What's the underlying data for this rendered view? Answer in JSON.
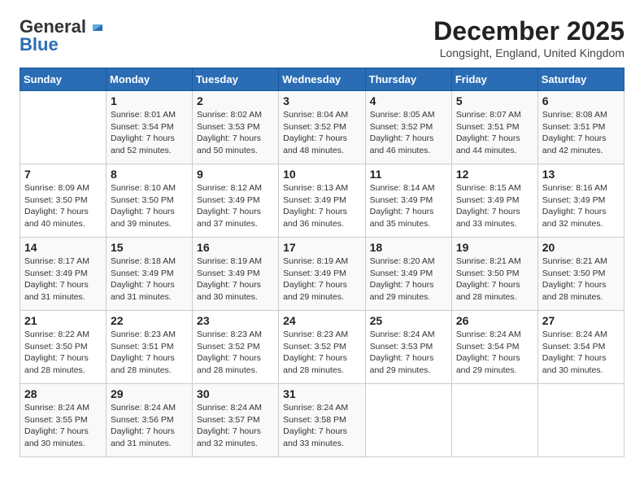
{
  "header": {
    "logo_general": "General",
    "logo_blue": "Blue",
    "month": "December 2025",
    "location": "Longsight, England, United Kingdom"
  },
  "days_of_week": [
    "Sunday",
    "Monday",
    "Tuesday",
    "Wednesday",
    "Thursday",
    "Friday",
    "Saturday"
  ],
  "weeks": [
    [
      {
        "day": "",
        "info": ""
      },
      {
        "day": "1",
        "info": "Sunrise: 8:01 AM\nSunset: 3:54 PM\nDaylight: 7 hours\nand 52 minutes."
      },
      {
        "day": "2",
        "info": "Sunrise: 8:02 AM\nSunset: 3:53 PM\nDaylight: 7 hours\nand 50 minutes."
      },
      {
        "day": "3",
        "info": "Sunrise: 8:04 AM\nSunset: 3:52 PM\nDaylight: 7 hours\nand 48 minutes."
      },
      {
        "day": "4",
        "info": "Sunrise: 8:05 AM\nSunset: 3:52 PM\nDaylight: 7 hours\nand 46 minutes."
      },
      {
        "day": "5",
        "info": "Sunrise: 8:07 AM\nSunset: 3:51 PM\nDaylight: 7 hours\nand 44 minutes."
      },
      {
        "day": "6",
        "info": "Sunrise: 8:08 AM\nSunset: 3:51 PM\nDaylight: 7 hours\nand 42 minutes."
      }
    ],
    [
      {
        "day": "7",
        "info": "Sunrise: 8:09 AM\nSunset: 3:50 PM\nDaylight: 7 hours\nand 40 minutes."
      },
      {
        "day": "8",
        "info": "Sunrise: 8:10 AM\nSunset: 3:50 PM\nDaylight: 7 hours\nand 39 minutes."
      },
      {
        "day": "9",
        "info": "Sunrise: 8:12 AM\nSunset: 3:49 PM\nDaylight: 7 hours\nand 37 minutes."
      },
      {
        "day": "10",
        "info": "Sunrise: 8:13 AM\nSunset: 3:49 PM\nDaylight: 7 hours\nand 36 minutes."
      },
      {
        "day": "11",
        "info": "Sunrise: 8:14 AM\nSunset: 3:49 PM\nDaylight: 7 hours\nand 35 minutes."
      },
      {
        "day": "12",
        "info": "Sunrise: 8:15 AM\nSunset: 3:49 PM\nDaylight: 7 hours\nand 33 minutes."
      },
      {
        "day": "13",
        "info": "Sunrise: 8:16 AM\nSunset: 3:49 PM\nDaylight: 7 hours\nand 32 minutes."
      }
    ],
    [
      {
        "day": "14",
        "info": "Sunrise: 8:17 AM\nSunset: 3:49 PM\nDaylight: 7 hours\nand 31 minutes."
      },
      {
        "day": "15",
        "info": "Sunrise: 8:18 AM\nSunset: 3:49 PM\nDaylight: 7 hours\nand 31 minutes."
      },
      {
        "day": "16",
        "info": "Sunrise: 8:19 AM\nSunset: 3:49 PM\nDaylight: 7 hours\nand 30 minutes."
      },
      {
        "day": "17",
        "info": "Sunrise: 8:19 AM\nSunset: 3:49 PM\nDaylight: 7 hours\nand 29 minutes."
      },
      {
        "day": "18",
        "info": "Sunrise: 8:20 AM\nSunset: 3:49 PM\nDaylight: 7 hours\nand 29 minutes."
      },
      {
        "day": "19",
        "info": "Sunrise: 8:21 AM\nSunset: 3:50 PM\nDaylight: 7 hours\nand 28 minutes."
      },
      {
        "day": "20",
        "info": "Sunrise: 8:21 AM\nSunset: 3:50 PM\nDaylight: 7 hours\nand 28 minutes."
      }
    ],
    [
      {
        "day": "21",
        "info": "Sunrise: 8:22 AM\nSunset: 3:50 PM\nDaylight: 7 hours\nand 28 minutes."
      },
      {
        "day": "22",
        "info": "Sunrise: 8:23 AM\nSunset: 3:51 PM\nDaylight: 7 hours\nand 28 minutes."
      },
      {
        "day": "23",
        "info": "Sunrise: 8:23 AM\nSunset: 3:52 PM\nDaylight: 7 hours\nand 28 minutes."
      },
      {
        "day": "24",
        "info": "Sunrise: 8:23 AM\nSunset: 3:52 PM\nDaylight: 7 hours\nand 28 minutes."
      },
      {
        "day": "25",
        "info": "Sunrise: 8:24 AM\nSunset: 3:53 PM\nDaylight: 7 hours\nand 29 minutes."
      },
      {
        "day": "26",
        "info": "Sunrise: 8:24 AM\nSunset: 3:54 PM\nDaylight: 7 hours\nand 29 minutes."
      },
      {
        "day": "27",
        "info": "Sunrise: 8:24 AM\nSunset: 3:54 PM\nDaylight: 7 hours\nand 30 minutes."
      }
    ],
    [
      {
        "day": "28",
        "info": "Sunrise: 8:24 AM\nSunset: 3:55 PM\nDaylight: 7 hours\nand 30 minutes."
      },
      {
        "day": "29",
        "info": "Sunrise: 8:24 AM\nSunset: 3:56 PM\nDaylight: 7 hours\nand 31 minutes."
      },
      {
        "day": "30",
        "info": "Sunrise: 8:24 AM\nSunset: 3:57 PM\nDaylight: 7 hours\nand 32 minutes."
      },
      {
        "day": "31",
        "info": "Sunrise: 8:24 AM\nSunset: 3:58 PM\nDaylight: 7 hours\nand 33 minutes."
      },
      {
        "day": "",
        "info": ""
      },
      {
        "day": "",
        "info": ""
      },
      {
        "day": "",
        "info": ""
      }
    ]
  ]
}
